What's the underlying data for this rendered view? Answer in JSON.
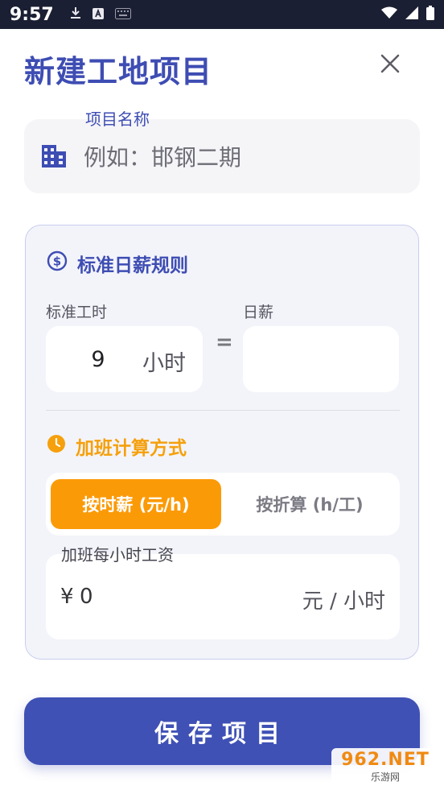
{
  "status_bar": {
    "time": "9:57",
    "icons": [
      "download-icon",
      "a-icon",
      "keyboard-icon",
      "wifi-icon",
      "signal-icon",
      "battery-icon"
    ]
  },
  "header": {
    "title": "新建工地项目",
    "close_icon": "close-icon"
  },
  "project_name": {
    "label": "项目名称",
    "placeholder": "例如：邯钢二期",
    "value": "",
    "icon": "building-icon"
  },
  "daily_wage_rules": {
    "title": "标准日薪规则",
    "icon": "dollar-circle-icon",
    "standard_hours_label": "标准工时",
    "standard_hours_value": "9",
    "hours_unit": "小时",
    "equals": "=",
    "daily_wage_label": "日薪",
    "daily_wage_value": ""
  },
  "overtime": {
    "title": "加班计算方式",
    "icon": "clock-icon",
    "modes": [
      {
        "label": "按时薪 (元/h)",
        "selected": true
      },
      {
        "label": "按折算 (h/工)",
        "selected": false
      }
    ],
    "hourly_label": "加班每小时工资",
    "currency": "¥",
    "hourly_value": "0",
    "unit": "元 / 小时"
  },
  "save_button": {
    "label": "保存项目"
  },
  "watermark": {
    "line1": "962.NET",
    "line2": "乐游网"
  },
  "colors": {
    "primary": "#3f51b5",
    "accent_orange": "#fb9a07",
    "status_bar": "#1b1f33"
  }
}
